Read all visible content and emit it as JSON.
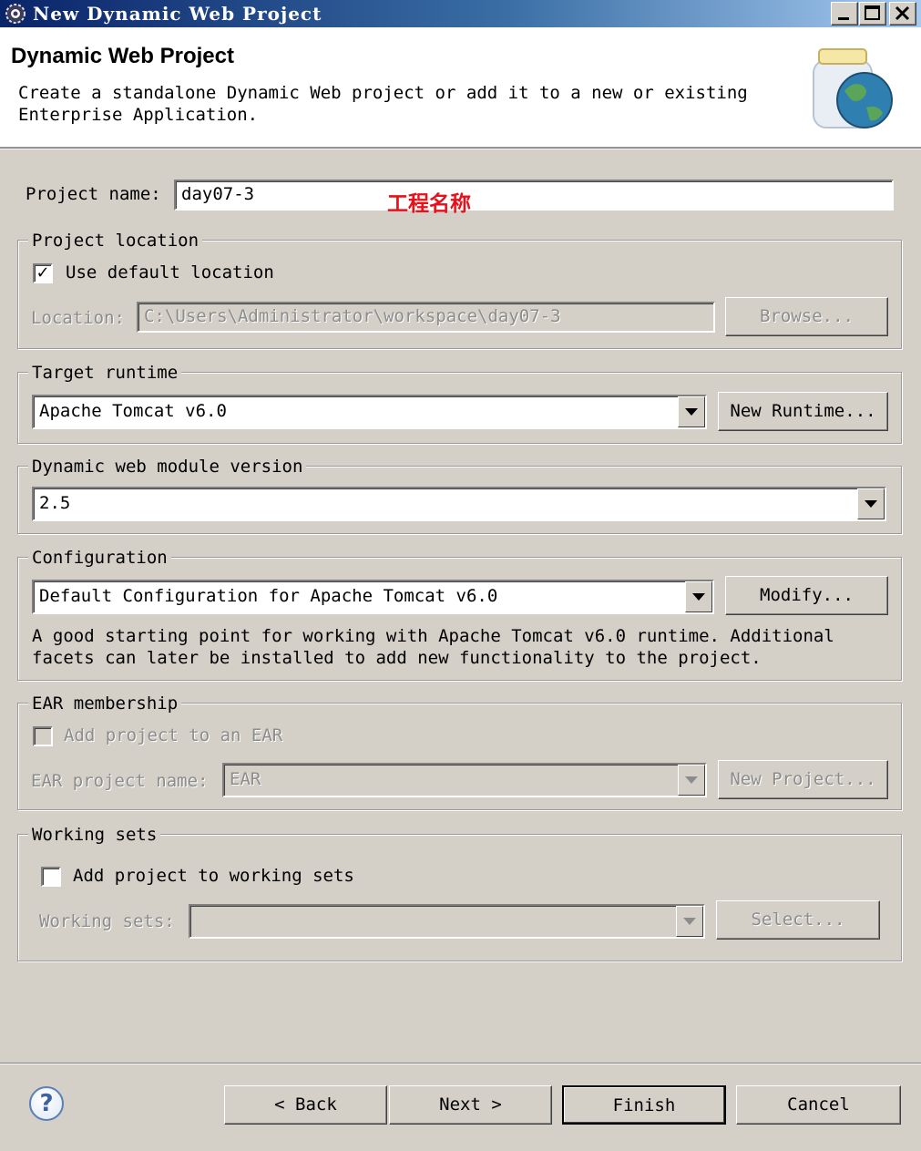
{
  "window": {
    "title": "New Dynamic Web Project"
  },
  "header": {
    "title": "Dynamic Web Project",
    "description": "Create a standalone Dynamic Web project or add it to a new or existing\nEnterprise Application."
  },
  "project_name": {
    "label": "Project name:",
    "value": "day07-3",
    "annotation": "工程名称",
    "annotation_color": "#e8101a"
  },
  "project_location": {
    "legend": "Project location",
    "use_default_label": "Use default location",
    "use_default_checked": true,
    "location_label": "Location:",
    "location_value": "C:\\Users\\Administrator\\workspace\\day07-3",
    "browse_label": "Browse..."
  },
  "target_runtime": {
    "legend": "Target runtime",
    "value": "Apache Tomcat v6.0",
    "new_runtime_label": "New Runtime..."
  },
  "module_version": {
    "legend": "Dynamic web module version",
    "value": "2.5"
  },
  "configuration": {
    "legend": "Configuration",
    "value": "Default Configuration for Apache Tomcat v6.0",
    "modify_label": "Modify...",
    "description": "A good starting point for working with Apache Tomcat v6.0 runtime. Additional\nfacets can later be installed to add new functionality to the project."
  },
  "ear": {
    "legend": "EAR membership",
    "add_label": "Add project to an EAR",
    "add_checked": false,
    "name_label": "EAR project name:",
    "name_value": "EAR",
    "new_project_label": "New Project..."
  },
  "working_sets": {
    "legend": "Working sets",
    "add_label": "Add project to working sets",
    "add_checked": false,
    "sets_label": "Working sets:",
    "sets_value": "",
    "select_label": "Select..."
  },
  "footer": {
    "help_symbol": "?",
    "back_label": "< Back",
    "next_label": "Next >",
    "finish_label": "Finish",
    "cancel_label": "Cancel"
  },
  "icons": {
    "app": "eclipse-gear-icon",
    "banner": "web-project-jar-globe-icon",
    "help": "help-question-icon"
  },
  "colors": {
    "title_bar_start": "#0a246a",
    "title_bar_end": "#a6caf0",
    "dialog_bg": "#d4d0c8"
  }
}
